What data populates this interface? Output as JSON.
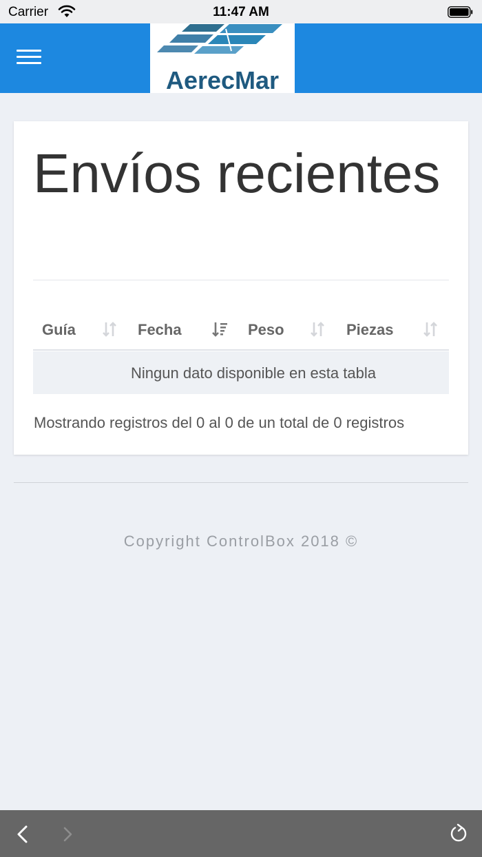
{
  "status_bar": {
    "carrier": "Carrier",
    "time": "11:47 AM"
  },
  "header": {
    "logo_text": "AerecMar",
    "menu_icon": "hamburger-menu-icon",
    "color": "#1d88e0"
  },
  "main": {
    "title": "Envíos recientes",
    "table": {
      "columns": [
        {
          "label": "Guía",
          "sort": "none"
        },
        {
          "label": "Fecha",
          "sort": "descending"
        },
        {
          "label": "Peso",
          "sort": "none"
        },
        {
          "label": "Piezas",
          "sort": "none"
        }
      ],
      "empty_message": "Ningun dato disponible en esta tabla"
    },
    "info": "Mostrando registros del 0 al 0 de un total de 0 registros"
  },
  "footer": {
    "copyright": "Copyright ControlBox 2018 ©"
  },
  "browser_bar": {
    "back_icon": "chevron-left-icon",
    "forward_icon": "chevron-right-icon",
    "reload_icon": "reload-icon"
  }
}
